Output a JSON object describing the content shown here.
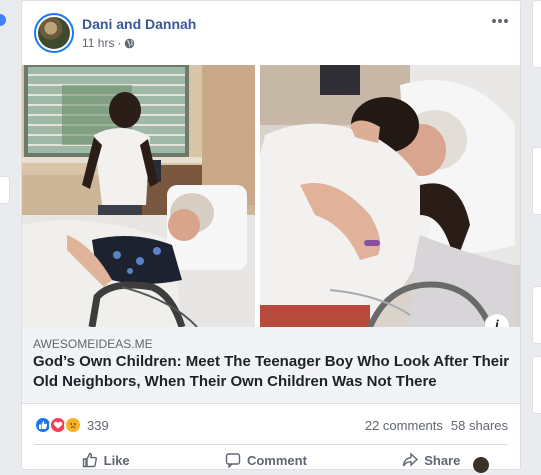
{
  "post": {
    "author": "Dani and Dannah",
    "time": "11 hrs",
    "separator": "·",
    "link": {
      "domain": "AWESOMEIDEAS.ME",
      "title": "God’s Own Children: Meet The Teenager Boy Who Look After Their Old Neighbors, When Their Own Children Was Not There"
    },
    "info_glyph": "i",
    "reactions": {
      "icons": [
        "like-icon",
        "love-icon",
        "sad-icon"
      ],
      "count": "339"
    },
    "comments": "22 comments",
    "shares": "58 shares"
  },
  "actions": [
    {
      "label": "Like",
      "icon": "thumbs-up-icon"
    },
    {
      "label": "Comment",
      "icon": "comment-icon"
    },
    {
      "label": "Share",
      "icon": "share-icon"
    }
  ],
  "colors": {
    "author": "#385898",
    "like": "#1877f2",
    "love": "#f33e58",
    "sad": "#f7b125",
    "link_bg": "#f2f3f5"
  }
}
